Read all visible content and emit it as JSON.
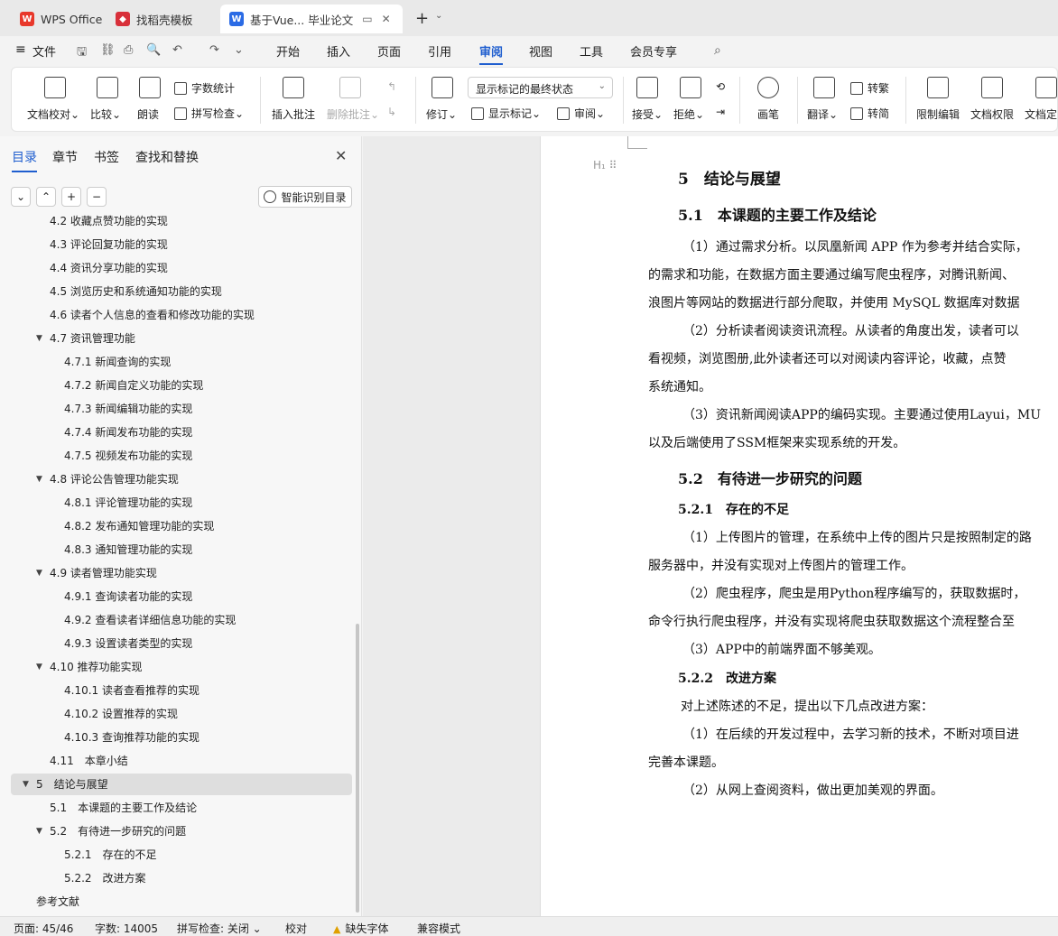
{
  "tabs": [
    {
      "label": "WPS Office",
      "icon": "wps-logo-icon"
    },
    {
      "label": "找稻壳模板",
      "icon": "docer-logo-icon"
    },
    {
      "label": "基于Vue... 毕业论文",
      "icon": "writer-doc-icon",
      "active": true
    }
  ],
  "menu": {
    "file": "文件",
    "items": [
      "开始",
      "插入",
      "页面",
      "引用",
      "审阅",
      "视图",
      "工具",
      "会员专享"
    ],
    "active": "审阅"
  },
  "ribbon": {
    "doc_proof": "文档校对",
    "compare": "比较",
    "read_aloud": "朗读",
    "word_count": "字数统计",
    "spell_check": "拼写检查",
    "insert_comment": "插入批注",
    "delete_comment": "删除批注",
    "track": "修订",
    "markup_state": "显示标记的最终状态",
    "show_markup": "显示标记",
    "review": "审阅",
    "accept": "接受",
    "reject": "拒绝",
    "pen": "画笔",
    "translate": "翻译",
    "to_traditional": "转繁",
    "to_simplified": "转简",
    "restrict_edit": "限制编辑",
    "doc_permission": "文档权限",
    "doc_final": "文档定稿"
  },
  "nav": {
    "tabs": [
      "目录",
      "章节",
      "书签",
      "查找和替换"
    ],
    "active_tab": "目录",
    "ai_toc": "智能识别目录",
    "toc": [
      {
        "text": "4.2 收藏点赞功能的实现",
        "level": 2
      },
      {
        "text": "4.3 评论回复功能的实现",
        "level": 2
      },
      {
        "text": "4.4 资讯分享功能的实现",
        "level": 2
      },
      {
        "text": "4.5 浏览历史和系统通知功能的实现",
        "level": 2
      },
      {
        "text": "4.6 读者个人信息的查看和修改功能的实现",
        "level": 2
      },
      {
        "text": "4.7 资讯管理功能",
        "level": 2,
        "expandable": true
      },
      {
        "text": "4.7.1 新闻查询的实现",
        "level": 3
      },
      {
        "text": "4.7.2 新闻自定义功能的实现",
        "level": 3
      },
      {
        "text": "4.7.3 新闻编辑功能的实现",
        "level": 3
      },
      {
        "text": "4.7.4 新闻发布功能的实现",
        "level": 3
      },
      {
        "text": "4.7.5 视频发布功能的实现",
        "level": 3
      },
      {
        "text": "4.8 评论公告管理功能实现",
        "level": 2,
        "expandable": true
      },
      {
        "text": "4.8.1 评论管理功能的实现",
        "level": 3
      },
      {
        "text": "4.8.2 发布通知管理功能的实现",
        "level": 3
      },
      {
        "text": "4.8.3 通知管理功能的实现",
        "level": 3
      },
      {
        "text": "4.9 读者管理功能实现",
        "level": 2,
        "expandable": true
      },
      {
        "text": "4.9.1 查询读者功能的实现",
        "level": 3
      },
      {
        "text": "4.9.2 查看读者详细信息功能的实现",
        "level": 3
      },
      {
        "text": "4.9.3 设置读者类型的实现",
        "level": 3
      },
      {
        "text": "4.10 推荐功能实现",
        "level": 2,
        "expandable": true
      },
      {
        "text": "4.10.1 读者查看推荐的实现",
        "level": 3
      },
      {
        "text": "4.10.2 设置推荐的实现",
        "level": 3
      },
      {
        "text": "4.10.3 查询推荐功能的实现",
        "level": 3
      },
      {
        "text": "4.11　本章小结",
        "level": 2
      },
      {
        "text": "5　结论与展望",
        "level": 1,
        "expandable": true,
        "selected": true
      },
      {
        "text": "5.1　本课题的主要工作及结论",
        "level": 2
      },
      {
        "text": "5.2　有待进一步研究的问题",
        "level": 2,
        "expandable": true
      },
      {
        "text": "5.2.1　存在的不足",
        "level": 3
      },
      {
        "text": "5.2.2　改进方案",
        "level": 3
      },
      {
        "text": "参考文献",
        "level": 1
      }
    ]
  },
  "document": {
    "lines": [
      {
        "type": "h1",
        "text": "5　结论与展望"
      },
      {
        "type": "h2",
        "text": "5.1　本课题的主要工作及结论"
      },
      {
        "type": "p",
        "text": "（1）通过需求分析。以凤凰新闻 APP 作为参考并结合实际，",
        "indent": true
      },
      {
        "type": "p",
        "text": "的需求和功能，在数据方面主要通过编写爬虫程序，对腾讯新闻、"
      },
      {
        "type": "p",
        "text": "浪图片等网站的数据进行部分爬取，并使用 MySQL 数据库对数据"
      },
      {
        "type": "p",
        "text": "（2）分析读者阅读资讯流程。从读者的角度出发，读者可以",
        "indent": true
      },
      {
        "type": "p",
        "text": "看视频，浏览图册,此外读者还可以对阅读内容评论，收藏，点赞"
      },
      {
        "type": "p",
        "text": "系统通知。"
      },
      {
        "type": "p",
        "text": "（3）资讯新闻阅读APP的编码实现。主要通过使用Layui，MU",
        "indent": true
      },
      {
        "type": "p",
        "text": "以及后端使用了SSM框架来实现系统的开发。"
      },
      {
        "type": "h2",
        "text": "5.2　有待进一步研究的问题"
      },
      {
        "type": "h3",
        "text": "5.2.1　存在的不足"
      },
      {
        "type": "p",
        "text": "（1）上传图片的管理，在系统中上传的图片只是按照制定的路",
        "indent": true
      },
      {
        "type": "p",
        "text": "服务器中，并没有实现对上传图片的管理工作。"
      },
      {
        "type": "p",
        "text": "（2）爬虫程序，爬虫是用Python程序编写的，获取数据时，",
        "indent": true
      },
      {
        "type": "p",
        "text": "命令行执行爬虫程序，并没有实现将爬虫获取数据这个流程整合至"
      },
      {
        "type": "p",
        "text": "（3）APP中的前端界面不够美观。",
        "indent": true
      },
      {
        "type": "h3",
        "text": "5.2.2　改进方案"
      },
      {
        "type": "p",
        "text": "对上述陈述的不足，提出以下几点改进方案：",
        "indent": true
      },
      {
        "type": "p",
        "text": "（1）在后续的开发过程中，去学习新的技术，不断对项目进",
        "indent": true
      },
      {
        "type": "p",
        "text": "完善本课题。"
      },
      {
        "type": "p",
        "text": "（2）从网上查阅资料，做出更加美观的界面。",
        "indent": true
      }
    ]
  },
  "status": {
    "page": "页面: 45/46",
    "words": "字数: 14005",
    "spell": "拼写检查: 关闭",
    "proof": "校对",
    "missing_font": "缺失字体",
    "compat": "兼容模式"
  },
  "colors": {
    "accent": "#1f5ecf",
    "wps_red": "#e8382b",
    "docer_red": "#d8303a",
    "writer_blue": "#2b6be5"
  }
}
